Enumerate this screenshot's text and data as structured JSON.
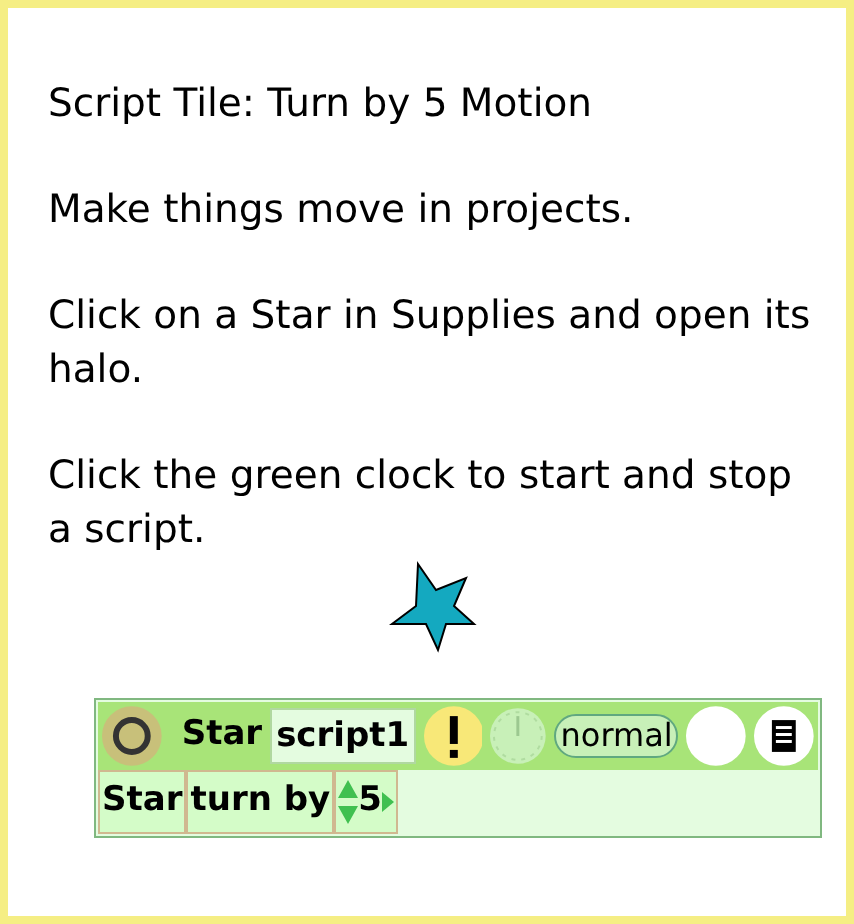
{
  "paragraphs": [
    "Script Tile: Turn by 5 Motion",
    "Make things move in projects.",
    "Click on a Star in Supplies and open its halo.",
    "Click the green clock to start and stop a script."
  ],
  "script": {
    "player": "Star",
    "name": "script1",
    "status": "normal",
    "tiles": [
      {
        "kind": "object",
        "label": "Star"
      },
      {
        "kind": "command",
        "label": "turn by"
      },
      {
        "kind": "number",
        "label": "5"
      }
    ]
  }
}
